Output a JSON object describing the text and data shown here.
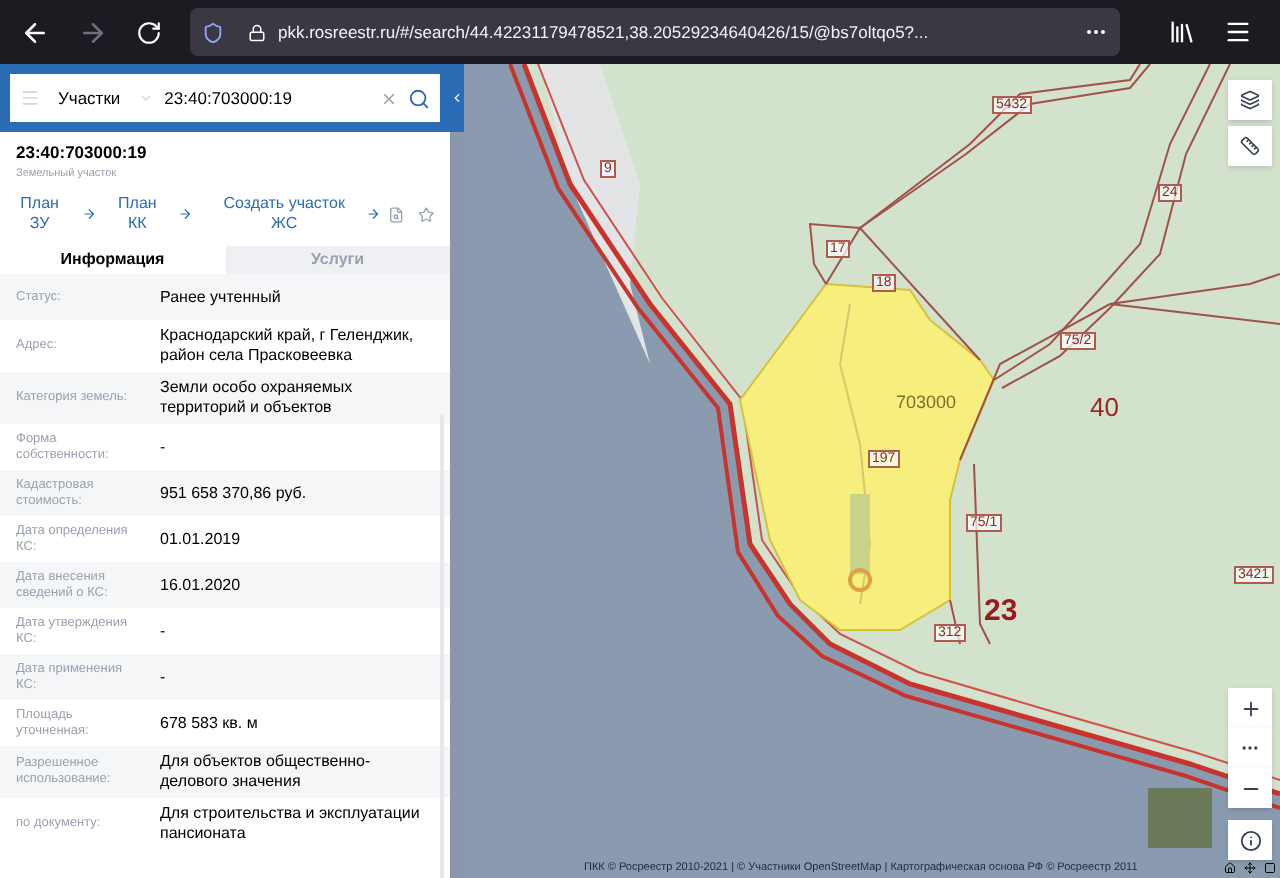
{
  "browser": {
    "url": "pkk.rosreestr.ru/#/search/44.42231179478521,38.20529234640426/15/@bs7oltqo5?...",
    "forward_disabled": true
  },
  "search": {
    "layer": "Участки",
    "value": "23:40:703000:19"
  },
  "card": {
    "title": "23:40:703000:19",
    "subtitle": "Земельный участок",
    "links": [
      "План ЗУ",
      "План КК",
      "Создать участок ЖС"
    ],
    "tabs": [
      {
        "label": "Информация",
        "selected": true
      },
      {
        "label": "Услуги",
        "selected": false
      }
    ],
    "rows": [
      {
        "label": "Статус:",
        "value": "Ранее учтенный"
      },
      {
        "label": "Адрес:",
        "value": "Краснодарский край, г Геленджик, район села Прасковеевка"
      },
      {
        "label": "Категория земель:",
        "value": "Земли особо охраняемых территорий и объектов"
      },
      {
        "label": "Форма собственности:",
        "value": "-"
      },
      {
        "label": "Кадастровая стоимость:",
        "value": "951 658 370,86 руб."
      },
      {
        "label": "Дата определения КС:",
        "value": "01.01.2019"
      },
      {
        "label": "Дата внесения сведений о КС:",
        "value": "16.01.2020"
      },
      {
        "label": "Дата утверждения КС:",
        "value": "-"
      },
      {
        "label": "Дата применения КС:",
        "value": "-"
      },
      {
        "label": "Площадь уточненная:",
        "value": "678 583 кв. м"
      },
      {
        "label": "Разрешенное использование:",
        "value": "Для объектов общественно-делового значения"
      },
      {
        "label": "по документу:",
        "value": "Для строительства и эксплуатации пансионата"
      }
    ]
  },
  "map": {
    "labels": [
      {
        "text": "5432",
        "kind": "small"
      },
      {
        "text": "9",
        "kind": "small"
      },
      {
        "text": "17",
        "kind": "small"
      },
      {
        "text": "18",
        "kind": "small"
      },
      {
        "text": "24",
        "kind": "small"
      },
      {
        "text": "703000",
        "kind": "parcel"
      },
      {
        "text": "40",
        "kind": "quarter"
      },
      {
        "text": "75/2",
        "kind": "small"
      },
      {
        "text": "75/1",
        "kind": "small"
      },
      {
        "text": "23",
        "kind": "district"
      },
      {
        "text": "312",
        "kind": "small"
      },
      {
        "text": "3421",
        "kind": "small"
      },
      {
        "text": "197",
        "kind": "small"
      }
    ],
    "attribution": "ПКК © Росреестр 2010-2021 | © Участники OpenStreetMap | Картографическая основа РФ © Росреестр 2011"
  }
}
